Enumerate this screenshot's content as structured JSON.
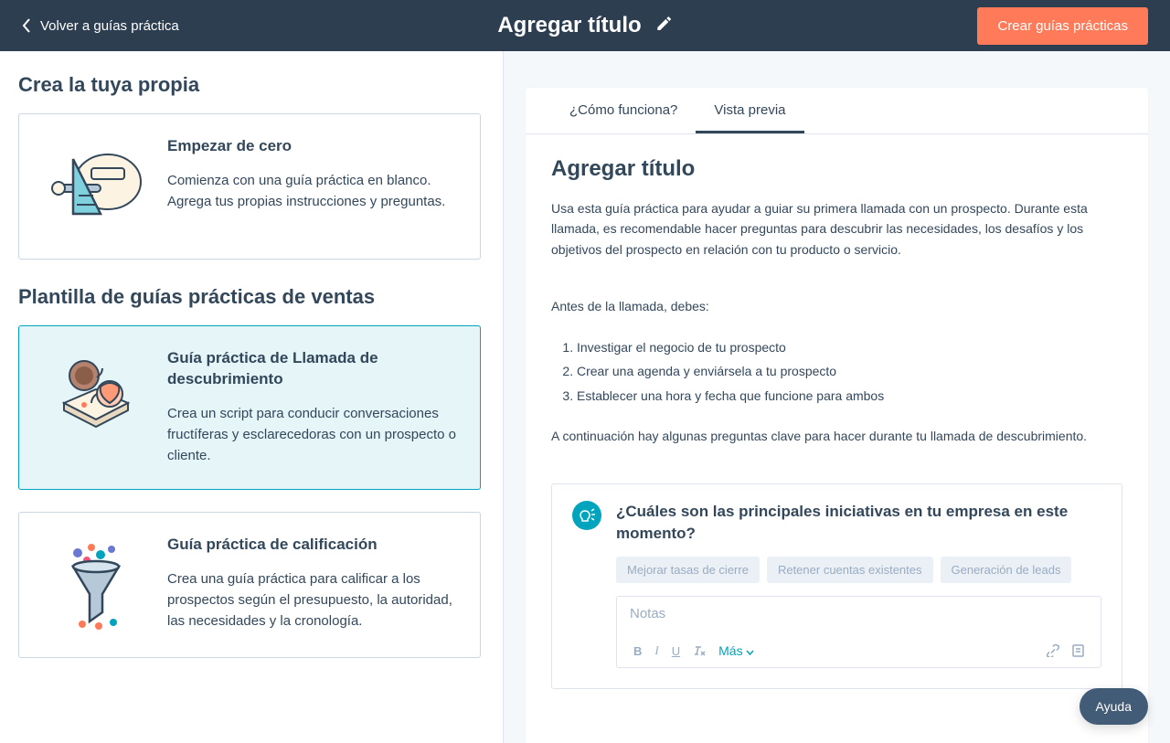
{
  "header": {
    "back": "Volver a guías práctica",
    "title": "Agregar título",
    "create": "Crear guías prácticas"
  },
  "left": {
    "section1": "Crea la tuya propia",
    "section2": "Plantilla de guías prácticas de ventas",
    "cards": [
      {
        "title": "Empezar de cero",
        "desc": "Comienza con una guía práctica en blanco. Agrega tus propias instrucciones y preguntas."
      },
      {
        "title": "Guía práctica de Llamada de descubrimiento",
        "desc": "Crea un script para conducir conversaciones fructíferas y esclarecedoras con un prospecto o cliente."
      },
      {
        "title": "Guía práctica de calificación",
        "desc": "Crea una guía práctica para calificar a los prospectos según el presupuesto, la autoridad, las necesidades y la cronología."
      }
    ]
  },
  "right": {
    "tabs": [
      "¿Cómo funciona?",
      "Vista previa"
    ],
    "preview": {
      "title": "Agregar título",
      "intro": "Usa esta guía práctica para ayudar a guiar su primera llamada con un prospecto. Durante esta llamada, es recomendable hacer preguntas para descubrir las necesidades, los desafíos y los objetivos del prospecto en relación con tu producto o servicio.",
      "prelist_label": "Antes de la llamada, debes:",
      "list": [
        "Investigar el negocio de tu prospecto",
        "Crear una agenda y enviársela a tu prospecto",
        "Establecer una hora y fecha que funcione para ambos"
      ],
      "after": "A continuación hay algunas preguntas clave para hacer durante tu llamada de descubrimiento.",
      "question": {
        "text": "¿Cuáles son las principales iniciativas en tu empresa en este momento?",
        "chips": [
          "Mejorar tasas de cierre",
          "Retener cuentas existentes",
          "Generación de leads"
        ],
        "notes_placeholder": "Notas",
        "more": "Más"
      }
    }
  },
  "help": "Ayuda"
}
